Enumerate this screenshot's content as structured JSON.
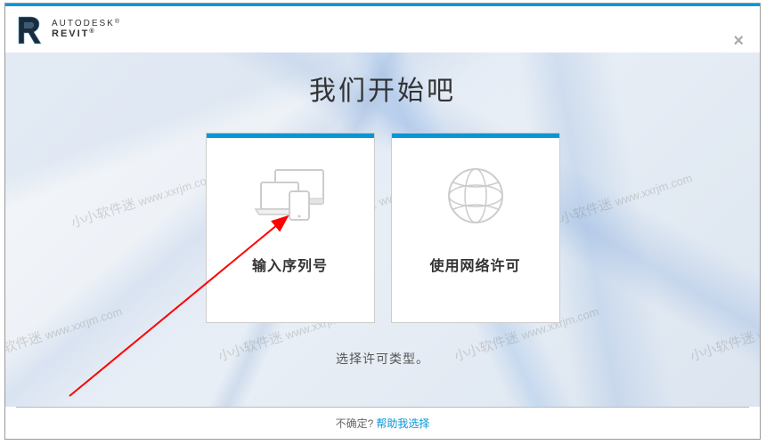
{
  "brand": {
    "line1": "AUTODESK",
    "line2": "REVIT"
  },
  "main_title": "我们开始吧",
  "cards": {
    "serial": {
      "label": "输入序列号"
    },
    "network": {
      "label": "使用网络许可"
    }
  },
  "subtitle": "选择许可类型。",
  "footer": {
    "question": "不确定?",
    "link": "帮助我选择"
  },
  "watermark": {
    "line1": "小小软件迷",
    "line2": "www.xxrjm.com"
  }
}
